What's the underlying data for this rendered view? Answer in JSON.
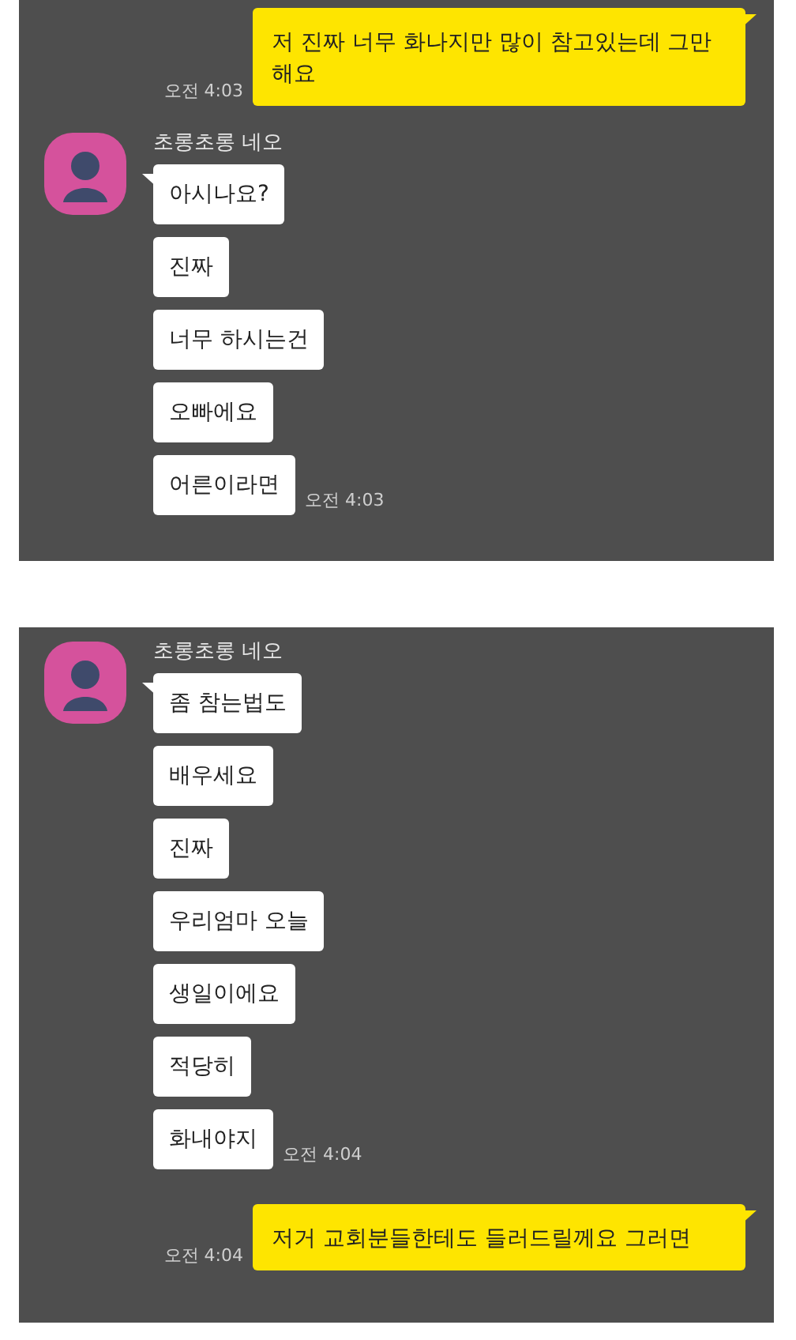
{
  "panels": [
    {
      "items": [
        {
          "kind": "sent",
          "text": "저 진짜 너무 화나지만 많이 참고있는데 그만해요",
          "time": "오전 4:03"
        },
        {
          "kind": "received",
          "sender": "초롱초롱 네오",
          "messages": [
            "아시나요?",
            "진짜",
            "너무 하시는건",
            "오빠에요",
            "어른이라면"
          ],
          "time": "오전 4:03"
        }
      ]
    },
    {
      "items": [
        {
          "kind": "received",
          "sender": "초롱초롱 네오",
          "messages": [
            "좀 참는법도",
            "배우세요",
            "진짜",
            "우리엄마 오늘",
            "생일이에요",
            "적당히",
            "화내야지"
          ],
          "time": "오전 4:04"
        },
        {
          "kind": "sent",
          "text": "저거 교회분들한테도 들러드릴께요 그러면",
          "time": "오전 4:04"
        }
      ]
    }
  ]
}
